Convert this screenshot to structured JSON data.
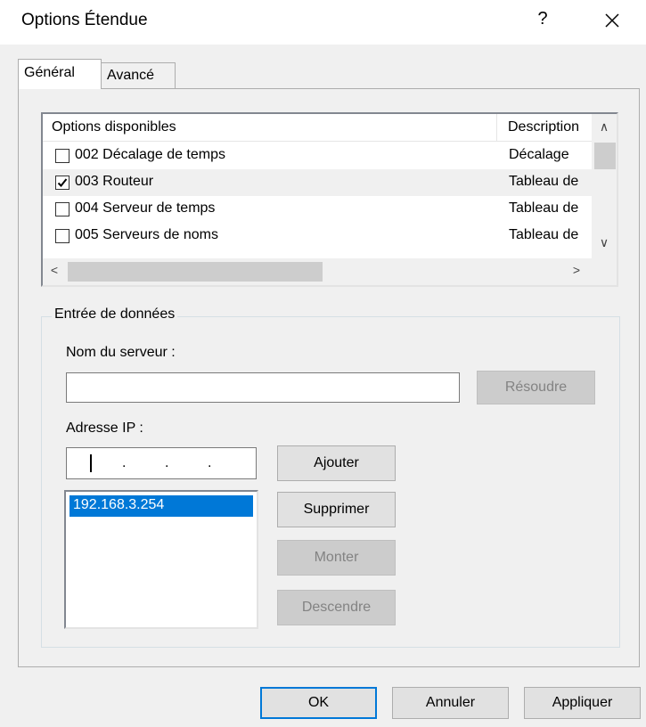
{
  "window": {
    "title": "Options Étendue",
    "help_glyph": "?",
    "close_glyph": "✕"
  },
  "tabs": [
    {
      "label": "Général",
      "selected": true
    },
    {
      "label": "Avancé",
      "selected": false
    }
  ],
  "options_list": {
    "columns": [
      "Options disponibles",
      "Description"
    ],
    "rows": [
      {
        "name": "002 Décalage de temps",
        "description": "Décalage",
        "checked": false
      },
      {
        "name": "003 Routeur",
        "description": "Tableau de",
        "checked": true
      },
      {
        "name": "004 Serveur de temps",
        "description": "Tableau de",
        "checked": false
      },
      {
        "name": "005 Serveurs de noms",
        "description": "Tableau de",
        "checked": false
      }
    ],
    "scroll_up_glyph": "∧",
    "scroll_down_glyph": "∨",
    "scroll_left_glyph": "<",
    "scroll_right_glyph": ">"
  },
  "data_entry": {
    "group_label": "Entrée de données",
    "server_name_label": "Nom du serveur :",
    "server_name_value": "",
    "resolve_button": "Résoudre",
    "ip_label": "Adresse IP :",
    "ip_dot": ".",
    "ip_list": [
      "192.168.3.254"
    ],
    "add_button": "Ajouter",
    "remove_button": "Supprimer",
    "up_button": "Monter",
    "down_button": "Descendre"
  },
  "footer": {
    "ok": "OK",
    "cancel": "Annuler",
    "apply": "Appliquer"
  },
  "colors": {
    "accent": "#0078d7",
    "dialog_bg": "#f0f0f0",
    "disabled_text": "#838383"
  }
}
